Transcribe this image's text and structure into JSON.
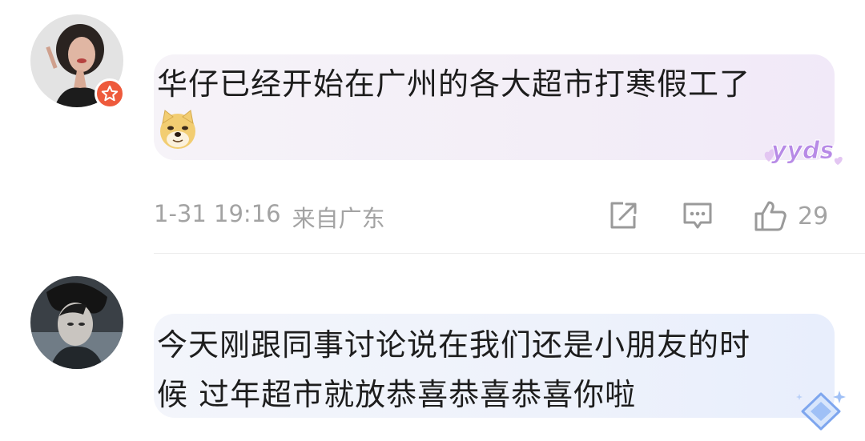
{
  "comments": [
    {
      "text": "华仔已经开始在广州的各大超市打寒假工了",
      "emoji": "doge-emoji",
      "time": "1-31 19:16",
      "location": "来自广东",
      "likes": "29",
      "decoration": "yyds",
      "avatar_badge": "vip-star-icon"
    },
    {
      "text_line1": "今天刚跟同事讨论说在我们还是小朋友的时",
      "text_line2": "候 过年超市就放恭喜恭喜恭喜你啦",
      "decoration": "diamond-icon"
    }
  ],
  "actions": {
    "share_icon": "share-icon",
    "comment_icon": "comment-icon",
    "like_icon": "thumbs-up-icon"
  },
  "colors": {
    "meta_text": "#a3a3a3",
    "badge": "#ee5a3c",
    "bubble1": "#f3eef7",
    "bubble2": "#eef2fb"
  }
}
